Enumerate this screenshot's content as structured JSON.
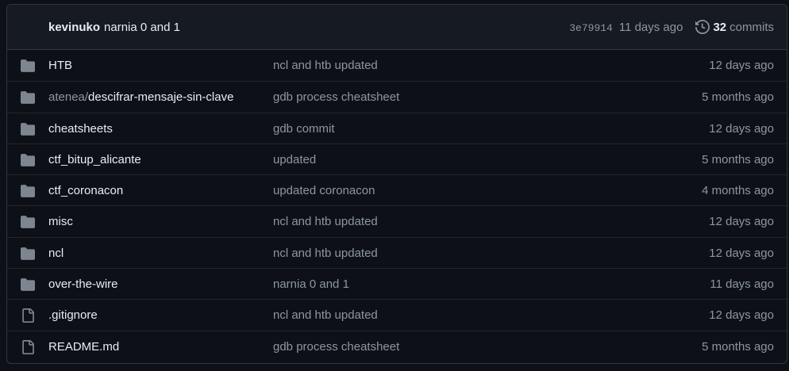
{
  "latest_commit": {
    "author": "kevinuko",
    "message": "narnia 0 and 1",
    "sha": "3e79914",
    "age": "11 days ago",
    "commit_count": "32",
    "commits_label": "commits",
    "history_icon": "history-icon"
  },
  "files": [
    {
      "type": "folder",
      "icon": "folder-icon",
      "prefix": "",
      "name": "HTB",
      "message": "ncl and htb updated",
      "age": "12 days ago"
    },
    {
      "type": "folder",
      "icon": "folder-icon",
      "prefix": "atenea/",
      "name": "descifrar-mensaje-sin-clave",
      "message": "gdb process cheatsheet",
      "age": "5 months ago"
    },
    {
      "type": "folder",
      "icon": "folder-icon",
      "prefix": "",
      "name": "cheatsheets",
      "message": "gdb commit",
      "age": "12 days ago"
    },
    {
      "type": "folder",
      "icon": "folder-icon",
      "prefix": "",
      "name": "ctf_bitup_alicante",
      "message": "updated",
      "age": "5 months ago"
    },
    {
      "type": "folder",
      "icon": "folder-icon",
      "prefix": "",
      "name": "ctf_coronacon",
      "message": "updated coronacon",
      "age": "4 months ago"
    },
    {
      "type": "folder",
      "icon": "folder-icon",
      "prefix": "",
      "name": "misc",
      "message": "ncl and htb updated",
      "age": "12 days ago"
    },
    {
      "type": "folder",
      "icon": "folder-icon",
      "prefix": "",
      "name": "ncl",
      "message": "ncl and htb updated",
      "age": "12 days ago"
    },
    {
      "type": "folder",
      "icon": "folder-icon",
      "prefix": "",
      "name": "over-the-wire",
      "message": "narnia 0 and 1",
      "age": "11 days ago"
    },
    {
      "type": "file",
      "icon": "file-icon",
      "prefix": "",
      "name": ".gitignore",
      "message": "ncl and htb updated",
      "age": "12 days ago"
    },
    {
      "type": "file",
      "icon": "file-icon",
      "prefix": "",
      "name": "README.md",
      "message": "gdb process cheatsheet",
      "age": "5 months ago"
    }
  ],
  "colors": {
    "background": "#0d1117",
    "header_background": "#161b22",
    "border": "#30363d",
    "icon": "#7d8590",
    "text_primary": "#e6edf3",
    "text_muted": "#8d96a0"
  }
}
